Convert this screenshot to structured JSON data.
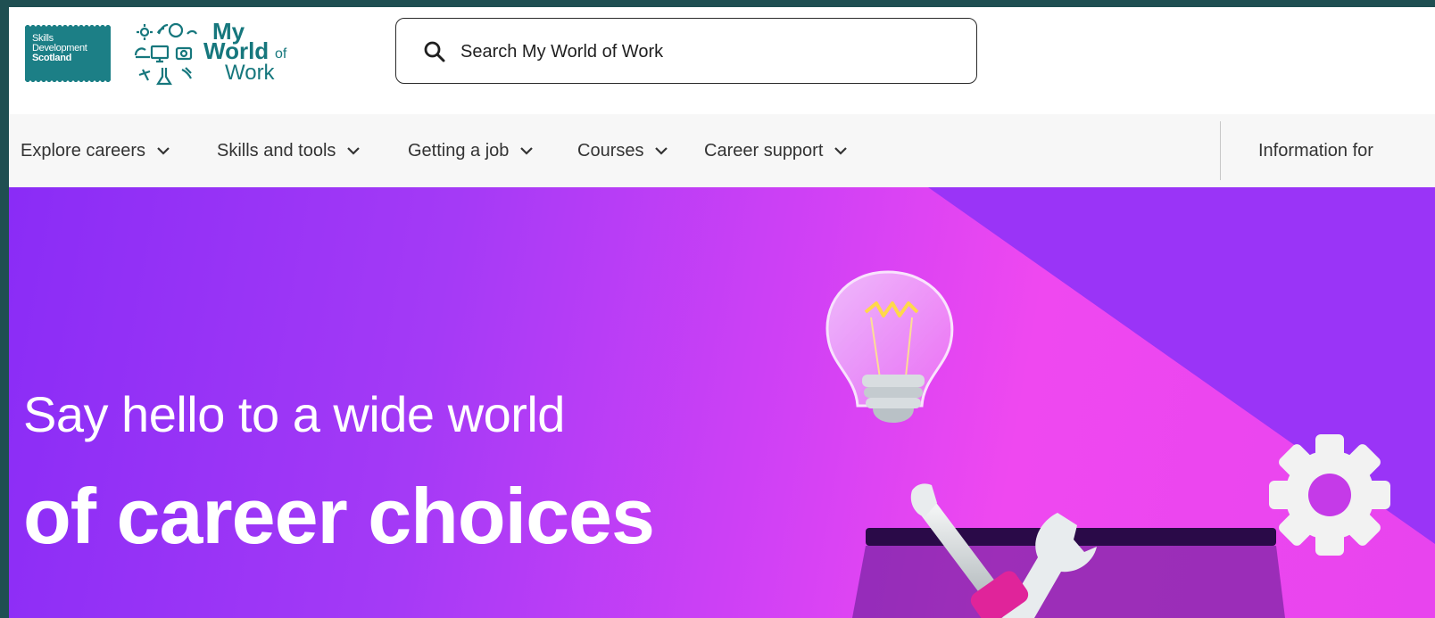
{
  "header": {
    "sds_logo": {
      "line1": "Skills",
      "line2": "Development",
      "line3": "Scotland"
    },
    "mwow_logo": {
      "my": "My",
      "world": "World",
      "of": "of",
      "work": "Work"
    },
    "search": {
      "placeholder": "Search My World of Work"
    }
  },
  "nav": {
    "items": [
      {
        "label": "Explore careers"
      },
      {
        "label": "Skills and tools"
      },
      {
        "label": "Getting a job"
      },
      {
        "label": "Courses"
      },
      {
        "label": "Career support"
      }
    ],
    "info_for": "Information for"
  },
  "hero": {
    "line1": "Say hello to a wide world",
    "line2": "of career choices"
  },
  "colors": {
    "brand_teal": "#16777d",
    "hero_purple": "#8a2cf6",
    "hero_pink": "#ef48f0"
  },
  "icons": [
    "search-icon",
    "chevron-down-icon",
    "lightbulb-icon",
    "gear-icon",
    "wrench-icon",
    "screwdriver-icon"
  ]
}
